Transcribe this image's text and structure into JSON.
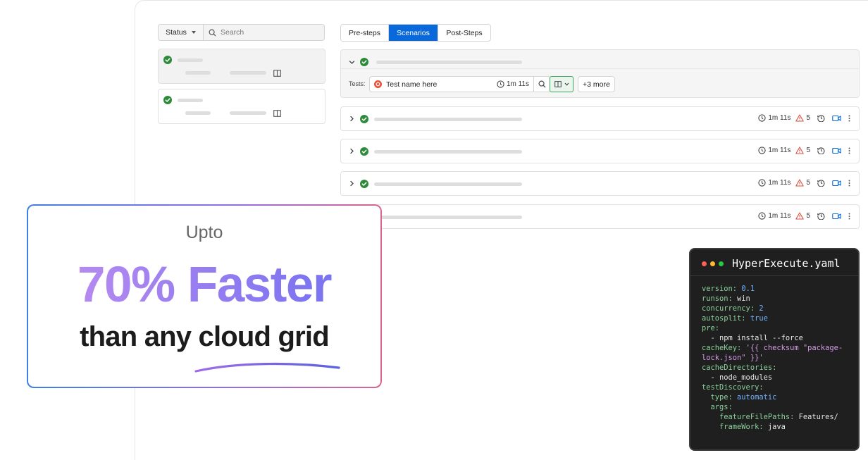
{
  "filters": {
    "status_label": "Status",
    "search_placeholder": "Search"
  },
  "tabs": [
    {
      "label": "Pre-steps",
      "active": false
    },
    {
      "label": "Scenarios",
      "active": true
    },
    {
      "label": "Post-Steps",
      "active": false
    }
  ],
  "expanded_scenario": {
    "tests_label": "Tests:",
    "test_name": "Test name here",
    "test_duration": "1m 11s",
    "more_label": "+3 more"
  },
  "scenarios": [
    {
      "duration": "1m 11s",
      "warnings": "5"
    },
    {
      "duration": "1m 11s",
      "warnings": "5"
    },
    {
      "duration": "1m 11s",
      "warnings": "5"
    },
    {
      "duration": "1m 11s",
      "warnings": "5"
    }
  ],
  "promo": {
    "upto": "Upto",
    "headline": "70% Faster",
    "subline": "than any cloud grid"
  },
  "code_window": {
    "title": "HyperExecute.yaml",
    "lines": [
      [
        [
          "k",
          "version: "
        ],
        [
          "b",
          "0.1"
        ]
      ],
      [
        [
          "k",
          "runson: "
        ],
        [
          "v",
          "win"
        ]
      ],
      [
        [
          "k",
          "concurrency: "
        ],
        [
          "b",
          "2"
        ]
      ],
      [
        [
          "k",
          "autosplit: "
        ],
        [
          "b",
          "true"
        ]
      ],
      [
        [
          "k",
          "pre:"
        ]
      ],
      [
        [
          "v",
          "  - npm install --force"
        ]
      ],
      [
        [
          "k",
          "cacheKey: "
        ],
        [
          "s",
          "'{{ checksum \"package-"
        ]
      ],
      [
        [
          "s",
          "lock.json\" }}'"
        ]
      ],
      [
        [
          "k",
          "cacheDirectories:"
        ]
      ],
      [
        [
          "v",
          "  - node_modules"
        ]
      ],
      [
        [
          "k",
          "testDiscovery:"
        ]
      ],
      [
        [
          "k",
          "  type: "
        ],
        [
          "b",
          "automatic"
        ]
      ],
      [
        [
          "k",
          "  args:"
        ]
      ],
      [
        [
          "k",
          "    featureFilePaths: "
        ],
        [
          "v",
          "Features/"
        ]
      ],
      [
        [
          "k",
          "    frameWork: "
        ],
        [
          "v",
          "java"
        ]
      ]
    ]
  },
  "colors": {
    "success": "#2e8b3a",
    "warning": "#d94f3d",
    "accent_blue": "#0a69da",
    "dot_red": "#ff5f57",
    "dot_yellow": "#febc2e",
    "dot_green": "#28c840"
  }
}
